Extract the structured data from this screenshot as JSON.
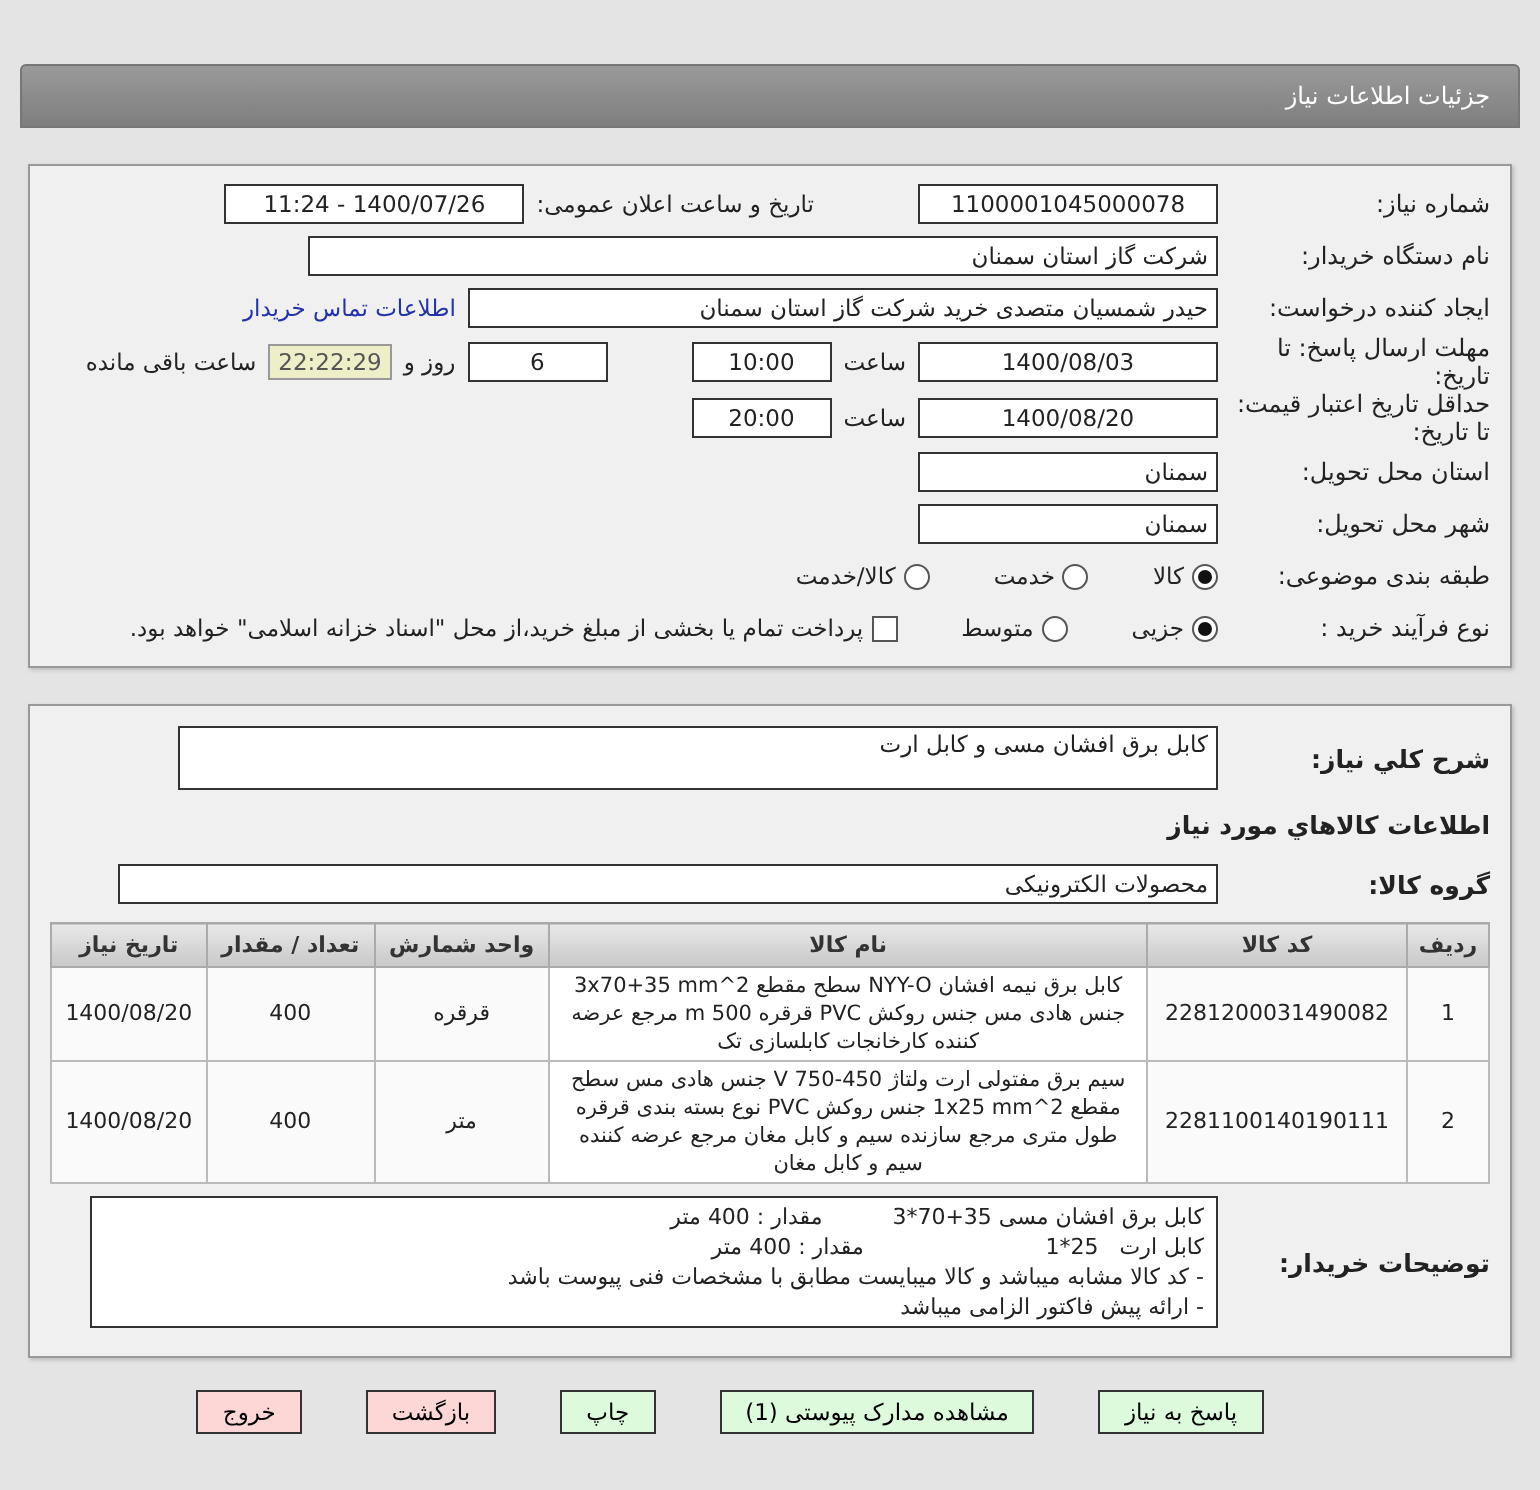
{
  "window": {
    "title": "جزئیات اطلاعات نیاز"
  },
  "need_number": {
    "label": "شماره نیاز:",
    "value": "1100001045000078"
  },
  "announce": {
    "label": "تاریخ و ساعت اعلان عمومی:",
    "value": "1400/07/26 - 11:24"
  },
  "buyer": {
    "label": "نام دستگاه خریدار:",
    "value": "شرکت گاز استان سمنان"
  },
  "creator": {
    "label": "ایجاد کننده درخواست:",
    "value": "حیدر شمسیان متصدی خرید شرکت گاز استان سمنان",
    "link": "اطلاعات تماس خریدار"
  },
  "deadline": {
    "label": "مهلت ارسال پاسخ: تا تاریخ:",
    "date": "1400/08/03",
    "time_label": "ساعت",
    "time": "10:00",
    "days": "6",
    "days_label": "روز و",
    "remaining": "22:22:29",
    "remaining_label": "ساعت باقی مانده"
  },
  "validity": {
    "label": "حداقل تاریخ اعتبار قیمت: تا تاریخ:",
    "date": "1400/08/20",
    "time_label": "ساعت",
    "time": "20:00"
  },
  "province": {
    "label": "استان محل تحویل:",
    "value": "سمنان"
  },
  "city": {
    "label": "شهر محل تحویل:",
    "value": "سمنان"
  },
  "category": {
    "label": "طبقه بندی موضوعی:",
    "options": [
      {
        "label": "کالا",
        "selected": true
      },
      {
        "label": "خدمت",
        "selected": false
      },
      {
        "label": "کالا/خدمت",
        "selected": false
      }
    ]
  },
  "process": {
    "label": "نوع فرآیند خرید :",
    "options": [
      {
        "label": "جزیی",
        "selected": true
      },
      {
        "label": "متوسط",
        "selected": false
      }
    ],
    "payment_checked": false,
    "payment_note": "پرداخت تمام یا بخشی از مبلغ خرید،از محل \"اسناد خزانه اسلامی\" خواهد بود."
  },
  "description": {
    "label": "شرح كلي نياز:",
    "value": "کابل برق افشان مسی و کابل ارت"
  },
  "goods_heading": "اطلاعات كالاهاي مورد نياز",
  "group": {
    "label": "گروه كالا:",
    "value": "محصولات الکترونیکی"
  },
  "table": {
    "columns": [
      "ردیف",
      "کد کالا",
      "نام کالا",
      "واحد شمارش",
      "تعداد / مقدار",
      "تاریخ نیاز"
    ],
    "rows": [
      [
        "1",
        "2281200031490082",
        "کابل برق نیمه افشان NYY-O سطح مقطع 2^3x70+35 mm جنس هادی مس جنس روکش PVC قرقره 500 m مرجع عرضه کننده کارخانجات کابلسازی تک",
        "قرقره",
        "400",
        "1400/08/20"
      ],
      [
        "2",
        "2281100140190111",
        "سیم برق مفتولی ارت ولتاژ 450-750 V جنس هادی مس سطح مقطع 2^1x25 mm جنس روکش PVC نوع بسته بندی قرقره طول متری مرجع سازنده سیم و کابل مغان مرجع عرضه کننده سیم و کابل مغان",
        "متر",
        "400",
        "1400/08/20"
      ]
    ]
  },
  "notes": {
    "label": "توضیحات خریدار:",
    "lines": [
      "کابل برق افشان مسی 35+70*3          مقدار : 400 متر",
      "کابل ارت   25*1                          مقدار : 400 متر",
      "- کد کالا مشابه میباشد و کالا میبایست مطابق با مشخصات فنی پیوست باشد",
      "- ارائه پیش فاکتور الزامی میباشد"
    ]
  },
  "buttons": [
    {
      "label": "پاسخ به نیاز",
      "kind": "green"
    },
    {
      "label": "مشاهده مدارک پیوستی (1)",
      "kind": "green"
    },
    {
      "label": "چاپ",
      "kind": "green"
    },
    {
      "label": "بازگشت",
      "kind": "red"
    },
    {
      "label": "خروج",
      "kind": "red"
    }
  ]
}
